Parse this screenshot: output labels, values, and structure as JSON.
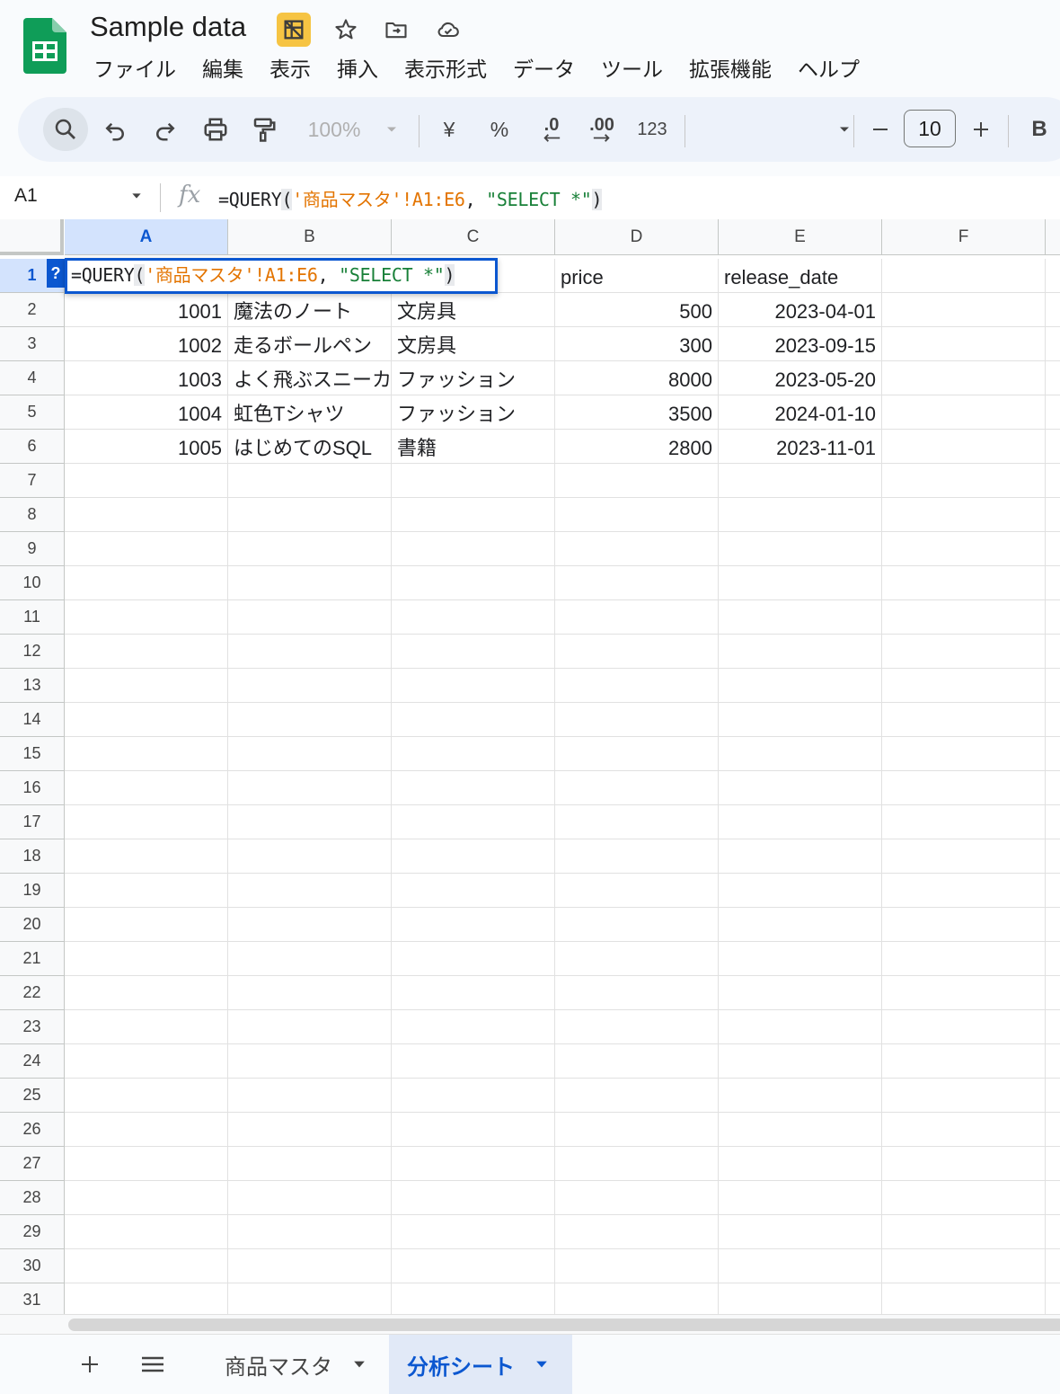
{
  "app": {
    "doc_title": "Sample data",
    "menu": [
      "ファイル",
      "編集",
      "表示",
      "挿入",
      "表示形式",
      "データ",
      "ツール",
      "拡張機能",
      "ヘルプ"
    ]
  },
  "toolbar": {
    "zoom": "100%",
    "currency": "¥",
    "percent": "%",
    "dec_decrease": ".0",
    "dec_increase": ".00",
    "number_format": "123",
    "font_size": "10",
    "bold": "B"
  },
  "formula_bar": {
    "name_box": "A1",
    "fx": "fx",
    "formula": {
      "fn": "=QUERY",
      "open": "(",
      "range": "'商品マスタ'!A1:E6",
      "comma": ", ",
      "query": "\"SELECT *\"",
      "close": ")"
    }
  },
  "grid": {
    "columns": [
      "A",
      "B",
      "C",
      "D",
      "E",
      "F"
    ],
    "row_numbers": [
      "1",
      "2",
      "3",
      "4",
      "5",
      "6",
      "7",
      "8",
      "9",
      "10",
      "11",
      "12",
      "13",
      "14",
      "15",
      "16",
      "17",
      "18",
      "19",
      "20",
      "21",
      "22",
      "23",
      "24",
      "25",
      "26",
      "27",
      "28",
      "29",
      "30",
      "31"
    ],
    "header_row": {
      "price": "price",
      "release_date": "release_date"
    },
    "rows": [
      {
        "id": "1001",
        "name": "魔法のノート",
        "category": "文房具",
        "price": "500",
        "release_date": "2023-04-01"
      },
      {
        "id": "1002",
        "name": "走るボールペン",
        "category": "文房具",
        "price": "300",
        "release_date": "2023-09-15"
      },
      {
        "id": "1003",
        "name": "よく飛ぶスニーカー",
        "category": "ファッション",
        "price": "8000",
        "release_date": "2023-05-20"
      },
      {
        "id": "1004",
        "name": "虹色Tシャツ",
        "category": "ファッション",
        "price": "3500",
        "release_date": "2024-01-10"
      },
      {
        "id": "1005",
        "name": "はじめてのSQL",
        "category": "書籍",
        "price": "2800",
        "release_date": "2023-11-01"
      }
    ],
    "help_badge": "?"
  },
  "sheets": {
    "tabs": [
      "商品マスタ",
      "分析シート"
    ],
    "active": "分析シート"
  },
  "colors": {
    "accent": "#0b57d0",
    "selection": "#d3e3fd",
    "string_token": "#e37400",
    "literal_token": "#188038"
  }
}
